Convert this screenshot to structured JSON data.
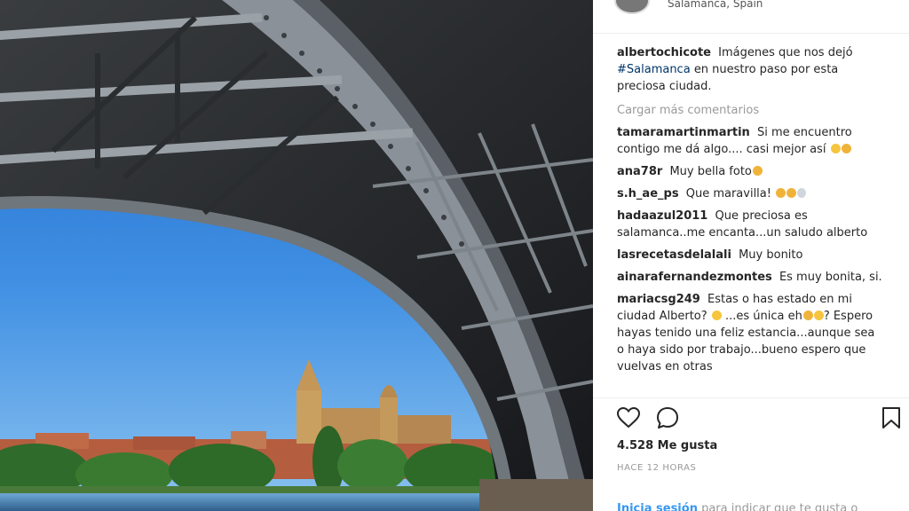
{
  "post": {
    "location": "Salamanca, Spain"
  },
  "caption": {
    "user": "albertochicote",
    "text_before": "Imágenes que nos dejó",
    "hashtag": "#Salamanca",
    "text_after": "en nuestro paso por esta preciosa ciudad."
  },
  "load_more": "Cargar más comentarios",
  "comments": [
    {
      "user": "tamaramartinmartin",
      "text": "Si me encuentro contigo me dá algo.... casi mejor así"
    },
    {
      "user": "ana78r",
      "text": "Muy bella foto"
    },
    {
      "user": "s.h_ae_ps",
      "text": "Que maravilla!"
    },
    {
      "user": "hadaazul2011",
      "text": "Que preciosa es salamanca..me encanta...un saludo alberto"
    },
    {
      "user": "lasrecetasdelalali",
      "text": "Muy bonito"
    },
    {
      "user": "ainarafernandezmontes",
      "text": "Es muy bonita, si."
    },
    {
      "user": "mariacsg249",
      "text_1": "Estas o has estado en mi ciudad Alberto?",
      "text_2": "...es única eh",
      "text_3": "? Espero hayas tenido una feliz estancia...aunque sea o haya sido por trabajo...bueno espero que vuelvas en otras"
    }
  ],
  "likes": "4.528 Me gusta",
  "time": "HACE 12 HORAS",
  "login": {
    "link": "Inicia sesión",
    "text": "para indicar que te gusta o"
  },
  "icons": {
    "like": "heart-icon",
    "comment": "comment-icon",
    "save": "bookmark-icon"
  },
  "colors": {
    "link": "#3897f0",
    "hashtag": "#003569"
  }
}
